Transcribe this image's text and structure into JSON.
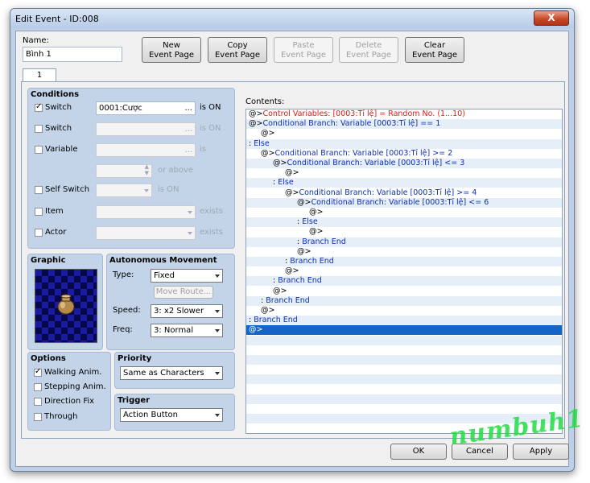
{
  "window": {
    "title": "Edit Event - ID:008",
    "close_label": "X"
  },
  "name_section": {
    "label": "Name:",
    "value": "Bình 1"
  },
  "toolbar": {
    "new": "New\nEvent Page",
    "copy": "Copy\nEvent Page",
    "paste": "Paste\nEvent Page",
    "delete": "Delete\nEvent Page",
    "clear": "Clear\nEvent Page"
  },
  "tab": {
    "label": "1"
  },
  "conditions": {
    "title": "Conditions",
    "switch1": {
      "label": "Switch",
      "checked": true,
      "value": "0001:Cược",
      "dots": "...",
      "suffix": "is ON"
    },
    "switch2": {
      "label": "Switch",
      "checked": false,
      "value": "",
      "dots": "...",
      "suffix": "is ON"
    },
    "variable": {
      "label": "Variable",
      "checked": false,
      "value": "",
      "dots": "...",
      "suffix": "is",
      "or_above": "or above"
    },
    "self_switch": {
      "label": "Self Switch",
      "checked": false,
      "suffix": "is ON"
    },
    "item": {
      "label": "Item",
      "checked": false,
      "suffix": "exists"
    },
    "actor": {
      "label": "Actor",
      "checked": false,
      "suffix": "exists"
    }
  },
  "graphic": {
    "title": "Graphic"
  },
  "autonomous": {
    "title": "Autonomous Movement",
    "type_label": "Type:",
    "type_value": "Fixed",
    "move_route": "Move Route...",
    "speed_label": "Speed:",
    "speed_value": "3: x2 Slower",
    "freq_label": "Freq:",
    "freq_value": "3: Normal"
  },
  "options": {
    "title": "Options",
    "walking": {
      "label": "Walking Anim.",
      "checked": true
    },
    "stepping": {
      "label": "Stepping Anim.",
      "checked": false
    },
    "direction": {
      "label": "Direction Fix",
      "checked": false
    },
    "through": {
      "label": "Through",
      "checked": false
    }
  },
  "priority": {
    "title": "Priority",
    "value": "Same as Characters"
  },
  "trigger": {
    "title": "Trigger",
    "value": "Action Button"
  },
  "contents": {
    "label": "Contents:",
    "lines": [
      {
        "prefix": "@>",
        "text": "Control Variables: [0003:Tỉ lệ] = Random No. (1...10)",
        "indent": 0,
        "color": "red"
      },
      {
        "prefix": "@>",
        "text": "Conditional Branch: Variable [0003:Tỉ lệ] == 1",
        "indent": 0,
        "color": "blue"
      },
      {
        "prefix": "@>",
        "text": "",
        "indent": 1,
        "color": "black"
      },
      {
        "prefix": ": ",
        "text": "Else",
        "indent": 0,
        "color": "blue"
      },
      {
        "prefix": "@>",
        "text": "Conditional Branch: Variable [0003:Tỉ lệ] >= 2",
        "indent": 1,
        "color": "blue"
      },
      {
        "prefix": "@>",
        "text": "Conditional Branch: Variable [0003:Tỉ lệ] <= 3",
        "indent": 2,
        "color": "blue"
      },
      {
        "prefix": "@>",
        "text": "",
        "indent": 3,
        "color": "black"
      },
      {
        "prefix": ": ",
        "text": "Else",
        "indent": 2,
        "color": "blue"
      },
      {
        "prefix": "@>",
        "text": "Conditional Branch: Variable [0003:Tỉ lệ] >= 4",
        "indent": 3,
        "color": "blue"
      },
      {
        "prefix": "@>",
        "text": "Conditional Branch: Variable [0003:Tỉ lệ] <= 6",
        "indent": 4,
        "color": "blue"
      },
      {
        "prefix": "@>",
        "text": "",
        "indent": 5,
        "color": "black"
      },
      {
        "prefix": ": ",
        "text": "Else",
        "indent": 4,
        "color": "blue"
      },
      {
        "prefix": "@>",
        "text": "",
        "indent": 5,
        "color": "black"
      },
      {
        "prefix": ": ",
        "text": "Branch End",
        "indent": 4,
        "color": "blue"
      },
      {
        "prefix": "@>",
        "text": "",
        "indent": 4,
        "color": "black"
      },
      {
        "prefix": ": ",
        "text": "Branch End",
        "indent": 3,
        "color": "blue"
      },
      {
        "prefix": "@>",
        "text": "",
        "indent": 3,
        "color": "black"
      },
      {
        "prefix": ": ",
        "text": "Branch End",
        "indent": 2,
        "color": "blue"
      },
      {
        "prefix": "@>",
        "text": "",
        "indent": 2,
        "color": "black"
      },
      {
        "prefix": ": ",
        "text": "Branch End",
        "indent": 1,
        "color": "blue"
      },
      {
        "prefix": "@>",
        "text": "",
        "indent": 1,
        "color": "black"
      },
      {
        "prefix": ": ",
        "text": "Branch End",
        "indent": 0,
        "color": "blue"
      },
      {
        "prefix": "@>",
        "text": "",
        "indent": 0,
        "color": "black",
        "selected": true
      }
    ]
  },
  "footer": {
    "ok": "OK",
    "cancel": "Cancel",
    "apply": "Apply"
  },
  "watermark": "numbuh1"
}
